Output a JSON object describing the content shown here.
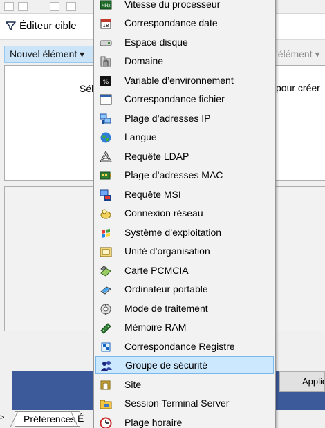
{
  "toolbar": {
    "filter_tab_label": "Éditeur cible",
    "new_element_label": "Nouvel élément ▾",
    "right_element_label": "l'élément ▾"
  },
  "main": {
    "select_text_left": "Séle",
    "select_text_right": "pour créer"
  },
  "buttons": {
    "apply_label": "Appliquer"
  },
  "tabs": [
    {
      "label": "Préférences"
    },
    {
      "label": "É"
    }
  ],
  "menu": {
    "items": [
      {
        "label": "Vitesse du processeur",
        "icon": "cpu-speed-icon"
      },
      {
        "label": "Correspondance date",
        "icon": "date-match-icon"
      },
      {
        "label": "Espace disque",
        "icon": "disk-space-icon"
      },
      {
        "label": "Domaine",
        "icon": "domain-icon"
      },
      {
        "label": "Variable d’environnement",
        "icon": "environment-variable-icon"
      },
      {
        "label": "Correspondance fichier",
        "icon": "file-match-icon"
      },
      {
        "label": "Plage d’adresses IP",
        "icon": "ip-range-icon"
      },
      {
        "label": "Langue",
        "icon": "language-globe-icon"
      },
      {
        "label": "Requête LDAP",
        "icon": "ldap-query-icon"
      },
      {
        "label": "Plage d’adresses MAC",
        "icon": "mac-range-icon"
      },
      {
        "label": "Requête MSI",
        "icon": "msi-query-icon"
      },
      {
        "label": "Connexion réseau",
        "icon": "network-connection-icon"
      },
      {
        "label": "Système d’exploitation",
        "icon": "operating-system-icon"
      },
      {
        "label": "Unité d’organisation",
        "icon": "organizational-unit-icon"
      },
      {
        "label": "Carte PCMCIA",
        "icon": "pcmcia-card-icon"
      },
      {
        "label": "Ordinateur portable",
        "icon": "laptop-icon"
      },
      {
        "label": "Mode de traitement",
        "icon": "processing-mode-icon"
      },
      {
        "label": "Mémoire RAM",
        "icon": "ram-memory-icon"
      },
      {
        "label": "Correspondance Registre",
        "icon": "registry-match-icon"
      },
      {
        "label": "Groupe de sécurité",
        "icon": "security-group-icon",
        "highlighted": true
      },
      {
        "label": "Site",
        "icon": "site-icon"
      },
      {
        "label": "Session Terminal Server",
        "icon": "terminal-session-icon"
      },
      {
        "label": "Plage horaire",
        "icon": "time-range-icon"
      }
    ]
  }
}
